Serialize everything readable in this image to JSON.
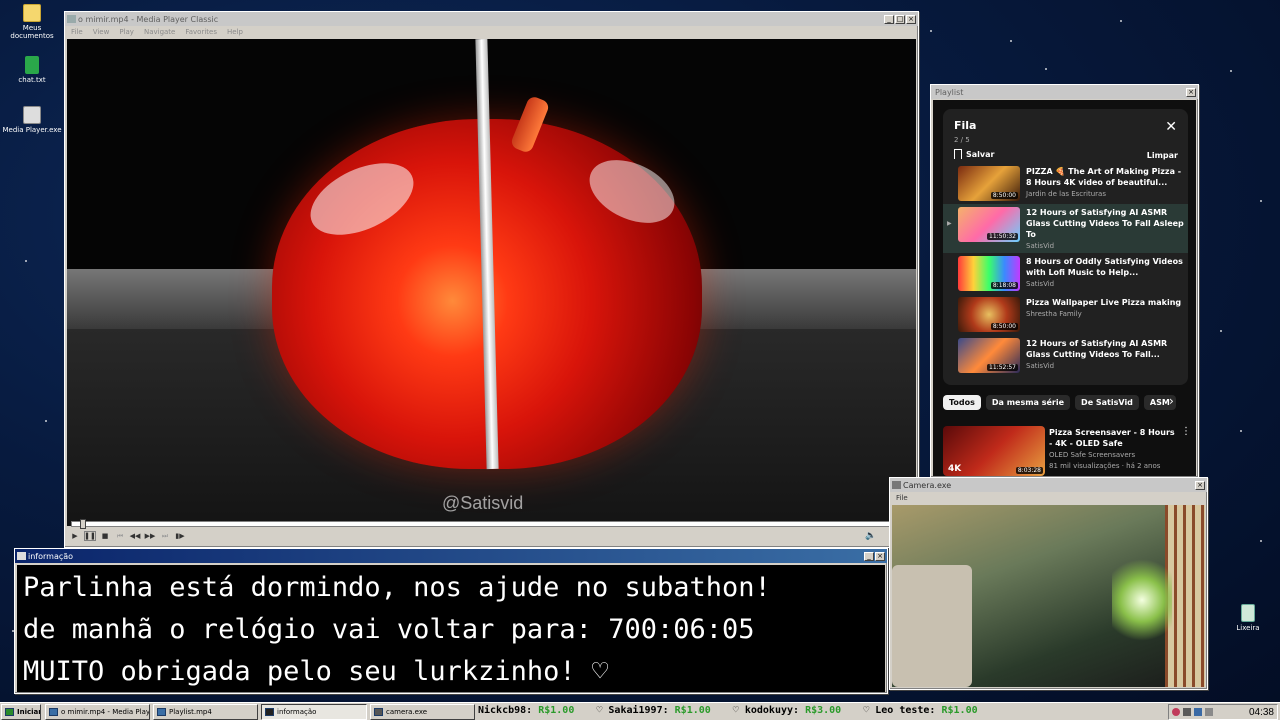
{
  "desktop": {
    "icons": [
      {
        "label": "Meus documentos",
        "icon": "folder-icon"
      },
      {
        "label": "chat.txt",
        "icon": "text-file-icon"
      },
      {
        "label": "Media Player.exe",
        "icon": "media-player-icon"
      },
      {
        "label": "Lixeira",
        "icon": "recycle-bin-icon"
      }
    ]
  },
  "media_player": {
    "title": "o mimir.mp4 - Media Player Classic",
    "menu": [
      "File",
      "View",
      "Play",
      "Navigate",
      "Favorites",
      "Help"
    ],
    "watermark": "@Satisvid",
    "seek_position": 0.01
  },
  "playlist_window": {
    "title": "Playlist",
    "queue_title": "Fila",
    "queue_position": "2 / 5",
    "save_label": "Salvar",
    "clear_label": "Limpar",
    "items": [
      {
        "title": "PIZZA 🍕 The Art of Making Pizza - 8 Hours 4K video of beautiful...",
        "channel": "Jardin de las Escrituras",
        "duration": "8:50:00",
        "active": false
      },
      {
        "title": "12 Hours of Satisfying AI ASMR Glass Cutting Videos To Fall Asleep To",
        "channel": "SatisVid",
        "duration": "11:50:32",
        "active": true
      },
      {
        "title": "8 Hours of Oddly Satisfying Videos with Lofi Music to Help...",
        "channel": "SatisVid",
        "duration": "8:18:08",
        "active": false
      },
      {
        "title": "Pizza Wallpaper Live Pizza making",
        "channel": "Shrestha Family",
        "duration": "8:50:00",
        "active": false
      },
      {
        "title": "12 Hours of Satisfying AI ASMR Glass Cutting Videos To Fall...",
        "channel": "SatisVid",
        "duration": "11:52:57",
        "active": false
      }
    ],
    "chips": [
      "Todos",
      "Da mesma série",
      "De SatisVid",
      "ASM"
    ],
    "recommended": {
      "title": "Pizza Screensaver - 8 Hours - 4K - OLED Safe",
      "channel": "OLED Safe Screensavers",
      "meta": "81 mil visualizações · há 2 anos",
      "duration": "8:03:28",
      "badge": "4K"
    }
  },
  "info_window": {
    "title": "informação",
    "lines": [
      "Parlinha está dormindo, nos ajude no subathon!",
      "de manhã o relógio vai voltar para:  700:06:05",
      "MUITO obrigada pelo seu lurkzinho! ♡"
    ]
  },
  "camera_window": {
    "title": "Camera.exe",
    "menu": [
      "File"
    ]
  },
  "taskbar": {
    "start_label": "Iniciar",
    "tasks": [
      {
        "label": "o mimir.mp4 - Media Playe...",
        "active": false
      },
      {
        "label": "Playlist.mp4",
        "active": false
      },
      {
        "label": "informação",
        "active": true
      },
      {
        "label": "camera.exe",
        "active": false
      }
    ],
    "ticker": [
      {
        "name": "Nickcb98:",
        "amount": "R$1.00"
      },
      {
        "name": "Sakai1997:",
        "amount": "R$1.00"
      },
      {
        "name": "kodokuyy:",
        "amount": "R$3.00"
      },
      {
        "name": "Leo teste:",
        "amount": "R$1.00"
      }
    ],
    "clock": "04:38"
  }
}
